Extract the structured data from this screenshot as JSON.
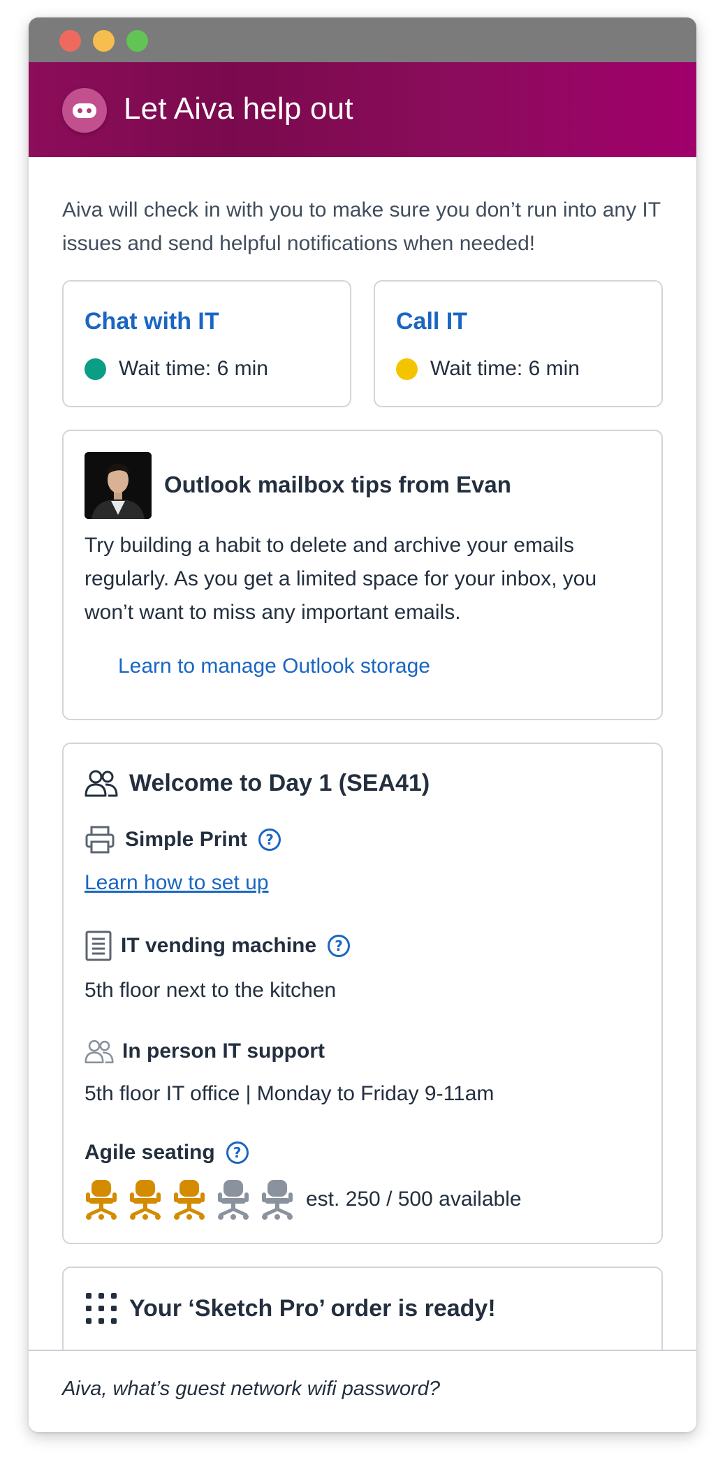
{
  "header": {
    "title": "Let Aiva help out",
    "brand_color": "#8c0d5a"
  },
  "intro": {
    "text": "Aiva will check in with you to make sure you don’t run into any IT issues and send helpful notifications when needed!"
  },
  "contact": [
    {
      "label": "Chat with IT",
      "wait": "Wait time: 6 min",
      "status_color": "#0a9e84"
    },
    {
      "label": "Call IT",
      "wait": "Wait time: 6 min",
      "status_color": "#f5c400"
    }
  ],
  "tip": {
    "title": "Outlook mailbox tips from Evan",
    "body": "Try building a habit to delete and archive your emails regularly. As you get a limited space for your inbox, you won’t want to miss any important emails.",
    "link": "Learn to manage Outlook storage"
  },
  "day1": {
    "title": "Welcome to Day 1 (SEA41)",
    "print": {
      "label": "Simple Print",
      "link": "Learn how to set up",
      "icon": "printer-icon"
    },
    "vending": {
      "label": "IT vending machine",
      "text": "5th floor next to the kitchen",
      "icon": "document-icon"
    },
    "support": {
      "label": "In person IT support",
      "text": "5th floor IT office | Monday to Friday 9-11am",
      "icon": "people-icon"
    },
    "seating": {
      "label": "Agile seating",
      "text": "est. 250 / 500 available",
      "occupied_chairs": 3,
      "total_chairs": 5,
      "occupied_color": "#d48b00",
      "free_color": "#8a939d"
    }
  },
  "order": {
    "title": "Your ‘Sketch Pro’ order is ready!",
    "icon": "grid-icon"
  },
  "footer": {
    "prompt": "Aiva, what’s guest network wifi password?"
  }
}
